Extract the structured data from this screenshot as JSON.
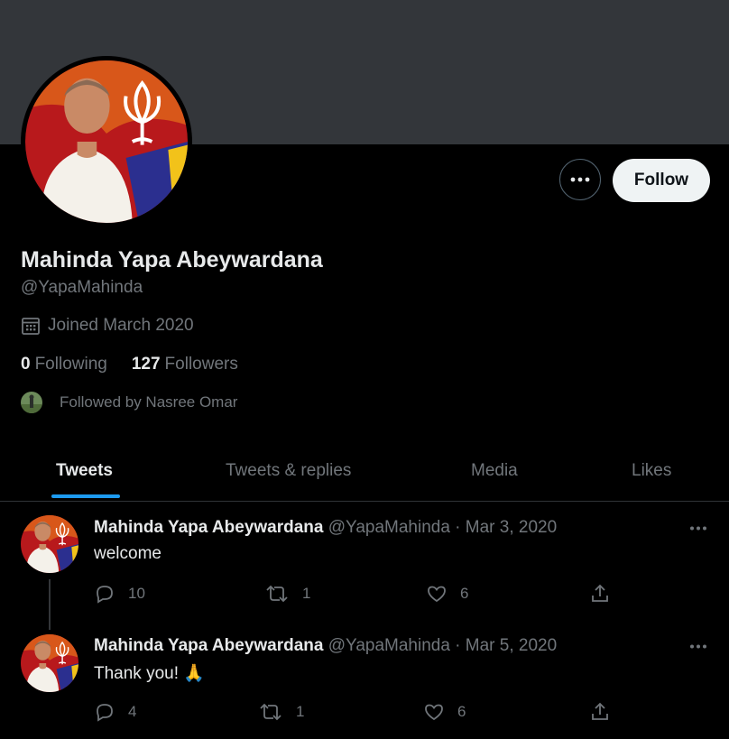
{
  "profile": {
    "name": "Mahinda Yapa Abeywardana",
    "handle": "@YapaMahinda",
    "joined": "Joined March 2020",
    "following_count": "0",
    "following_label": "Following",
    "followers_count": "127",
    "followers_label": "Followers",
    "followed_by": "Followed by Nasree Omar",
    "follow_button": "Follow"
  },
  "tabs": [
    {
      "label": "Tweets",
      "active": true
    },
    {
      "label": "Tweets & replies",
      "active": false
    },
    {
      "label": "Media",
      "active": false
    },
    {
      "label": "Likes",
      "active": false
    }
  ],
  "tweets": [
    {
      "name": "Mahinda Yapa Abeywardana",
      "meta": "@YapaMahinda · Mar 3, 2020",
      "text": "welcome",
      "replies": "10",
      "retweets": "1",
      "likes": "6"
    },
    {
      "name": "Mahinda Yapa Abeywardana",
      "meta": "@YapaMahinda · Mar 5, 2020",
      "text": "Thank you! 🙏",
      "replies": "4",
      "retweets": "1",
      "likes": "6"
    }
  ],
  "colors": {
    "accent": "#1d9bf0",
    "banner": "#33363a",
    "muted": "#71767b"
  },
  "icons": [
    "more-icon",
    "calendar-icon",
    "reply-icon",
    "retweet-icon",
    "like-icon",
    "share-icon"
  ]
}
